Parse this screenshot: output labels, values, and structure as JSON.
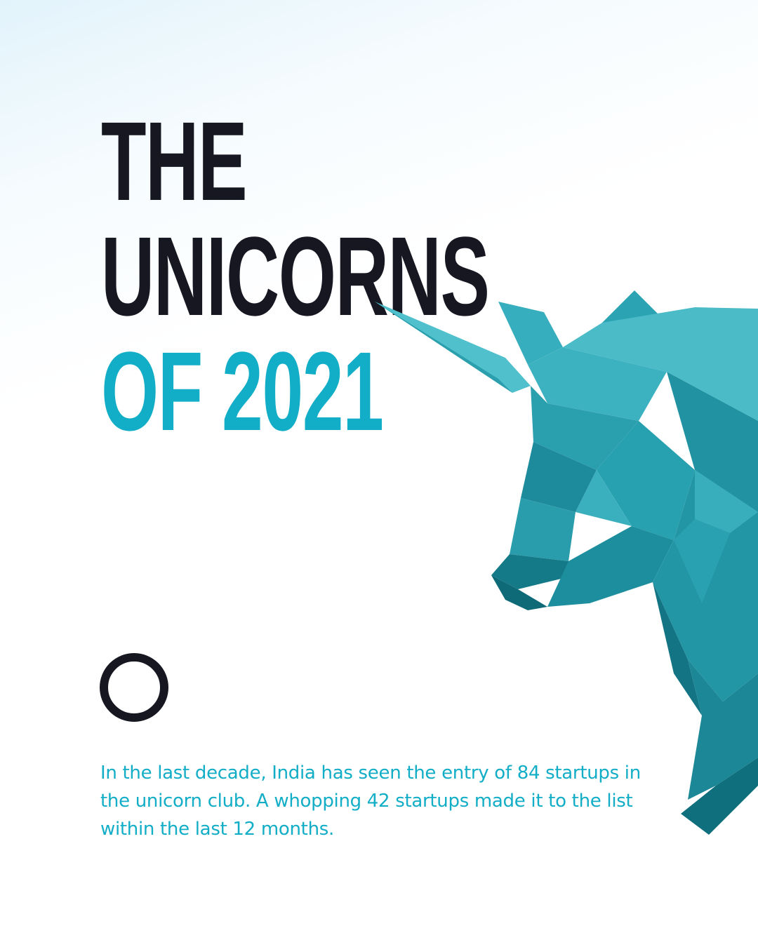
{
  "headline": {
    "line1": "THE",
    "line2": "UNICORNS",
    "line3": "OF 2021"
  },
  "body_text": "In the last decade, India has seen the entry of 84 startups in the unicorn club. A whopping 42 startups made it to the list within the last 12 months.",
  "colors": {
    "dark": "#171722",
    "accent": "#12adc6",
    "unicorn_light": "#3fb6c3",
    "unicorn_mid": "#1f97a6",
    "unicorn_dark": "#0f6f7c"
  },
  "icons": {
    "ring": "circle-outline-icon",
    "illustration": "low-poly-unicorn-head"
  }
}
